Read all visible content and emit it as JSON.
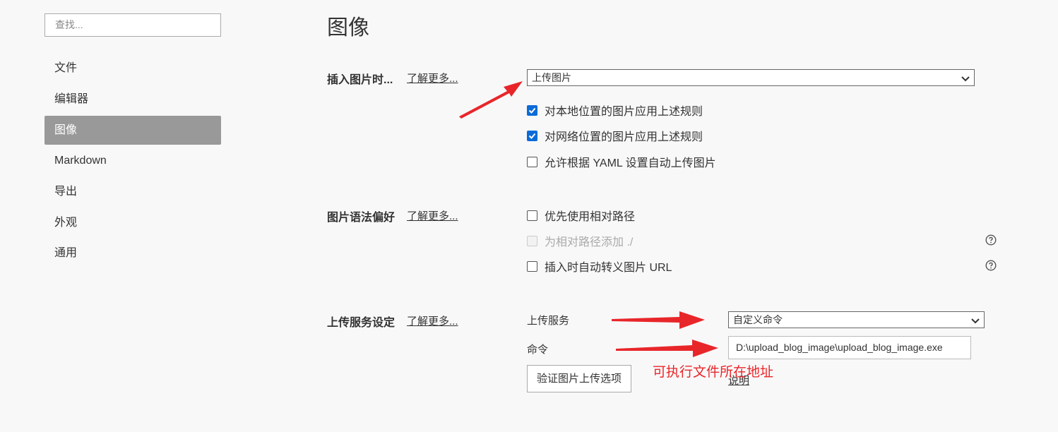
{
  "sidebar": {
    "search_placeholder": "查找...",
    "items": [
      {
        "label": "文件",
        "active": false
      },
      {
        "label": "编辑器",
        "active": false
      },
      {
        "label": "图像",
        "active": true
      },
      {
        "label": "Markdown",
        "active": false
      },
      {
        "label": "导出",
        "active": false
      },
      {
        "label": "外观",
        "active": false
      },
      {
        "label": "通用",
        "active": false
      }
    ]
  },
  "main": {
    "title": "图像",
    "learn_more": "了解更多...",
    "insert_section": {
      "title": "插入图片时...",
      "select_value": "上传图片",
      "options": [
        {
          "label": "对本地位置的图片应用上述规则",
          "checked": true
        },
        {
          "label": "对网络位置的图片应用上述规则",
          "checked": true
        },
        {
          "label": "允许根据 YAML 设置自动上传图片",
          "checked": false
        }
      ]
    },
    "syntax_section": {
      "title": "图片语法偏好",
      "options": [
        {
          "label": "优先使用相对路径",
          "checked": false,
          "disabled": false
        },
        {
          "label": "为相对路径添加 ./",
          "checked": false,
          "disabled": true
        },
        {
          "label": "插入时自动转义图片 URL",
          "checked": false,
          "disabled": false
        }
      ]
    },
    "upload_section": {
      "title": "上传服务设定",
      "service_label": "上传服务",
      "service_value": "自定义命令",
      "command_label": "命令",
      "command_value": "D:\\upload_blog_image\\upload_blog_image.exe",
      "verify_button": "验证图片上传选项",
      "explain_link": "说明"
    },
    "annotation_text": "可执行文件所在地址"
  },
  "colors": {
    "accent": "#0b6bd9",
    "annotation": "#e8262a",
    "sidebar_active": "#999999"
  }
}
